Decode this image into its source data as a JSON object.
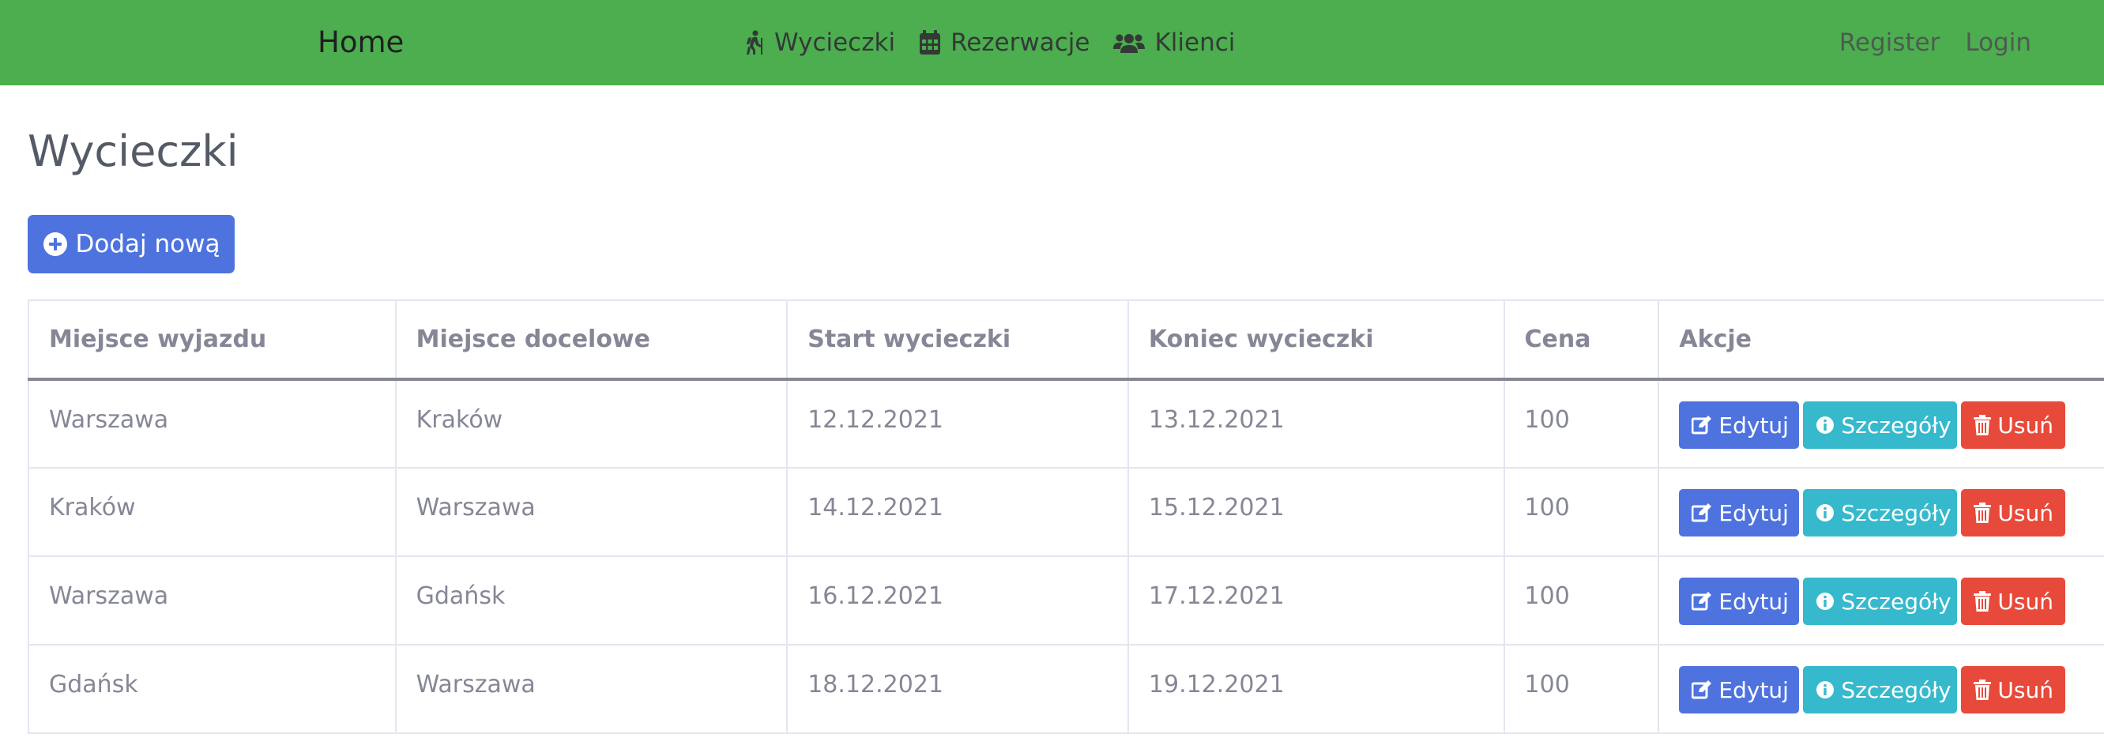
{
  "navbar": {
    "brand": "Home",
    "links": [
      {
        "label": "Wycieczki",
        "icon": "hiking-icon"
      },
      {
        "label": "Rezerwacje",
        "icon": "calendar-icon"
      },
      {
        "label": "Klienci",
        "icon": "users-icon"
      }
    ],
    "auth": {
      "register": "Register",
      "login": "Login"
    },
    "color": "#4cae4f"
  },
  "page": {
    "title": "Wycieczki",
    "add_button": "Dodaj nową"
  },
  "table": {
    "headers": [
      "Miejsce wyjazdu",
      "Miejsce docelowe",
      "Start wycieczki",
      "Koniec wycieczki",
      "Cena",
      "Akcje"
    ],
    "rows": [
      [
        "Warszawa",
        "Kraków",
        "12.12.2021",
        "13.12.2021",
        "100"
      ],
      [
        "Kraków",
        "Warszawa",
        "14.12.2021",
        "15.12.2021",
        "100"
      ],
      [
        "Warszawa",
        "Gdańsk",
        "16.12.2021",
        "17.12.2021",
        "100"
      ],
      [
        "Gdańsk",
        "Warszawa",
        "18.12.2021",
        "19.12.2021",
        "100"
      ]
    ],
    "actions": {
      "edit": "Edytuj",
      "details": "Szczegóły",
      "delete": "Usuń"
    }
  },
  "colors": {
    "primary": "#4e73df",
    "info": "#36b9cc",
    "danger": "#e74a3b"
  }
}
